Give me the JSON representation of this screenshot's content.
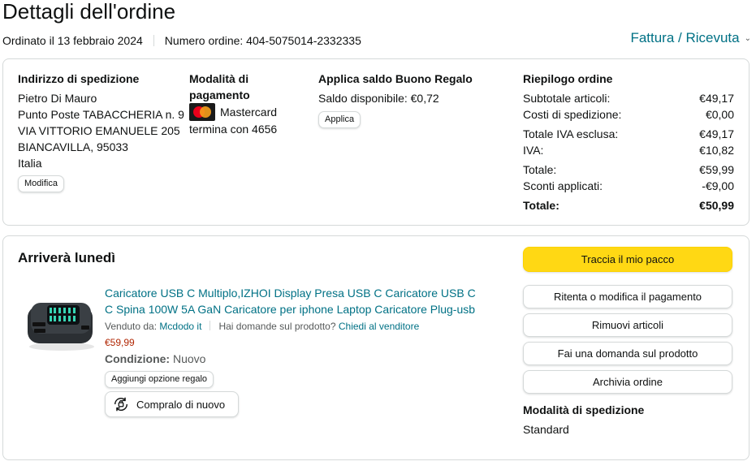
{
  "header": {
    "title": "Dettagli dell'ordine",
    "ordered_on": "Ordinato il 13 febbraio 2024",
    "order_number": "Numero ordine: 404-5075014-2332335",
    "invoice_link": "Fattura / Ricevuta"
  },
  "shipping_address": {
    "heading": "Indirizzo di spedizione",
    "lines": [
      "Pietro Di Mauro",
      "Punto Poste TABACCHERIA n. 9",
      "VIA VITTORIO EMANUELE 205",
      "BIANCAVILLA, 95033",
      "Italia"
    ],
    "edit_button": "Modifica"
  },
  "payment": {
    "heading": "Modalità di pagamento",
    "card_name": "Mastercard",
    "card_ending": "termina con 4656",
    "card_icon": "mastercard-icon"
  },
  "gift_card": {
    "heading": "Applica saldo Buono Regalo",
    "balance": "Saldo disponibile: €0,72",
    "apply_button": "Applica"
  },
  "summary": {
    "heading": "Riepilogo ordine",
    "rows": [
      {
        "label": "Subtotale articoli:",
        "value": "€49,17"
      },
      {
        "label": "Costi di spedizione:",
        "value": "€0,00"
      },
      {
        "label": "Totale IVA esclusa:",
        "value": "€49,17"
      },
      {
        "label": "IVA:",
        "value": "€10,82"
      },
      {
        "label": "Totale:",
        "value": "€59,99"
      },
      {
        "label": "Sconti applicati:",
        "value": "-€9,00"
      },
      {
        "label": "Totale:",
        "value": "€50,99"
      }
    ]
  },
  "shipment": {
    "arrival": "Arriverà lunedì",
    "product": {
      "title": "Caricatore USB C Multiplo,IZHOI Display Presa USB C Caricatore USB C C Spina 100W 5A GaN Caricatore per iphone Laptop Caricatore Plug-usb",
      "sold_by_label": "Venduto da:",
      "seller": "Mcdodo it",
      "question_label": "Hai domande sul prodotto?",
      "ask_seller": "Chiedi al venditore",
      "price": "€59,99",
      "condition_label": "Condizione:",
      "condition_value": "Nuovo",
      "gift_button": "Aggiungi opzione regalo",
      "buy_again_button": "Compralo di nuovo"
    },
    "actions": {
      "track": "Traccia il mio pacco",
      "retry_payment": "Ritenta o modifica il pagamento",
      "remove_items": "Rimuovi articoli",
      "ask_question": "Fai una domanda sul prodotto",
      "archive": "Archivia ordine"
    },
    "shipping_method_heading": "Modalità di spedizione",
    "shipping_method_value": "Standard"
  },
  "colors": {
    "link": "#007185",
    "price": "#b12704",
    "primary_button": "#ffd814",
    "border": "#d5d9d9"
  }
}
